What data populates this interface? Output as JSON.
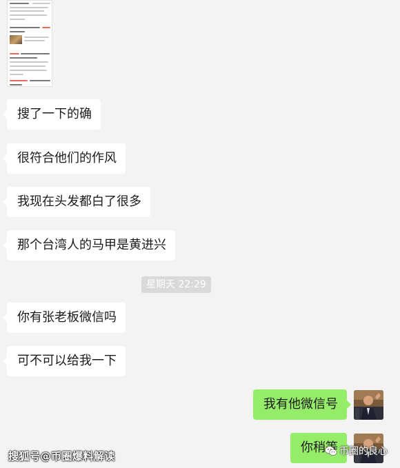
{
  "chat": {
    "messages": [
      {
        "side": "left",
        "text": "搜了一下的确"
      },
      {
        "side": "left",
        "text": "很符合他们的作风"
      },
      {
        "side": "left",
        "text": "我现在头发都白了很多"
      },
      {
        "side": "left",
        "text": "那个台湾人的马甲是黄进兴"
      },
      {
        "side": "left",
        "text": "你有张老板微信吗"
      },
      {
        "side": "left",
        "text": "可不可以给我一下"
      },
      {
        "side": "right",
        "text": "我有他微信号"
      },
      {
        "side": "right",
        "text": "你稍等"
      }
    ],
    "timestamp": "星期天 22:29"
  },
  "watermarks": {
    "left": "搜狐号@币圈爆料解读",
    "right": "币圈的良心"
  },
  "colors": {
    "background": "#f3f3f3",
    "bubble_left": "#ffffff",
    "bubble_right": "#95ec69",
    "timestamp_bg": "#d9d9d9"
  },
  "icons": {
    "wechat_logo": "wechat-icon"
  }
}
